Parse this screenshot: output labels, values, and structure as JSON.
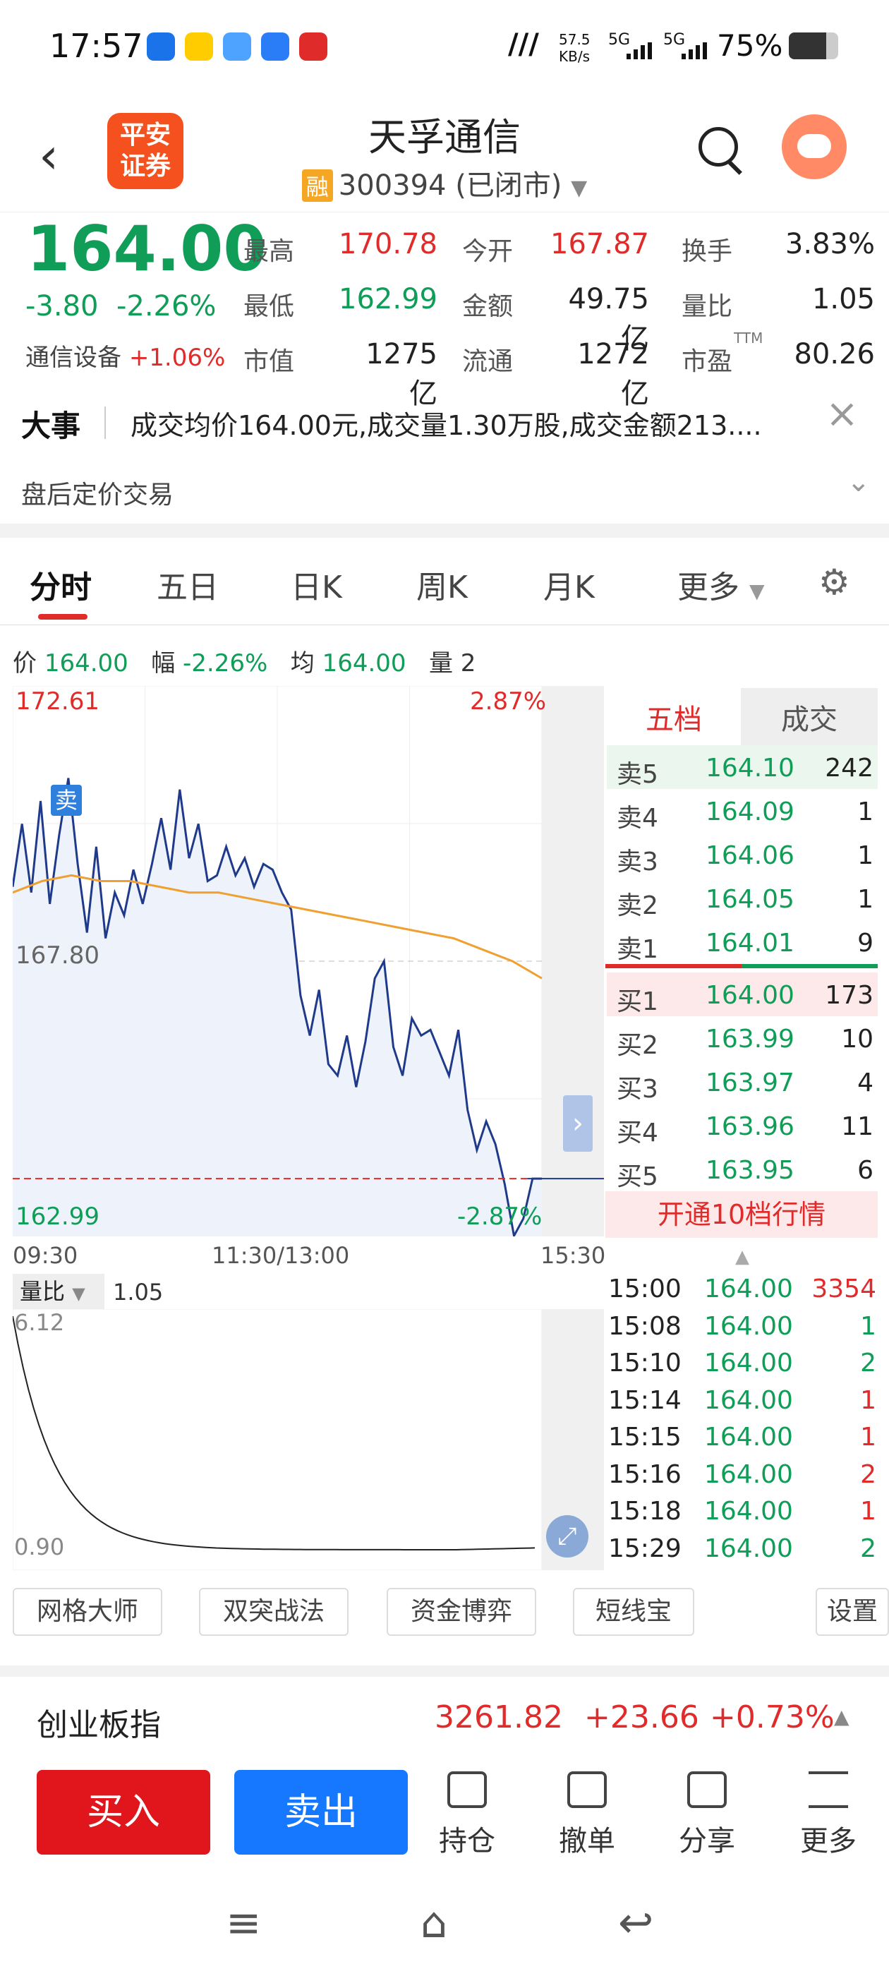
{
  "status_bar": {
    "time": "17:57",
    "speed": "57.5\nKB/s",
    "net1": "5G",
    "net2": "5G",
    "battery": "75%"
  },
  "header": {
    "logo_text": "平安\n证券",
    "title": "天孚通信",
    "tag": "融",
    "code": "300394 (已闭市)"
  },
  "quote": {
    "price": "164.00",
    "change": "-3.80",
    "change_pct": "-2.26%",
    "sector": "通信设备",
    "sector_pct": "+1.06%",
    "fields": [
      {
        "label": "最高",
        "value": "170.78",
        "color": "red"
      },
      {
        "label": "今开",
        "value": "167.87",
        "color": "red"
      },
      {
        "label": "换手",
        "value": "3.83%",
        "color": "dark"
      },
      {
        "label": "最低",
        "value": "162.99",
        "color": "green"
      },
      {
        "label": "金额",
        "value": "49.75亿",
        "color": "dark"
      },
      {
        "label": "量比",
        "value": "1.05",
        "color": "dark"
      },
      {
        "label": "市值",
        "value": "1275亿",
        "color": "dark"
      },
      {
        "label": "流通",
        "value": "1272亿",
        "color": "dark"
      },
      {
        "label": "市盈",
        "value": "80.26",
        "color": "dark",
        "sup": "TTM"
      }
    ]
  },
  "news": {
    "label": "大事",
    "text": "成交均价164.00元,成交量1.30万股,成交金额213....",
    "after_hours": "盘后定价交易"
  },
  "tabs": [
    "分时",
    "五日",
    "日K",
    "周K",
    "月K",
    "更多"
  ],
  "info_line": {
    "price_label": "价",
    "price": "164.00",
    "range_label": "幅",
    "range": "-2.26%",
    "avg_label": "均",
    "avg": "164.00",
    "vol_label": "量",
    "vol": "2"
  },
  "chart_labels": {
    "top_price": "172.61",
    "top_pct": "2.87%",
    "mid_price": "167.80",
    "bottom_price": "162.99",
    "bottom_pct": "-2.87%",
    "sell_marker": "卖",
    "time_start": "09:30",
    "time_mid": "11:30/13:00",
    "time_end": "15:30"
  },
  "chart_data": {
    "type": "line",
    "ylim": [
      162.99,
      172.61
    ],
    "series": [
      {
        "values": [
          169.1,
          170.2,
          169.0,
          170.6,
          168.8,
          170.0,
          171.0,
          169.5,
          168.3,
          169.8,
          168.2,
          169.0,
          168.6,
          169.4,
          168.8,
          169.5,
          170.3,
          169.4,
          170.8,
          169.6,
          170.2,
          169.2,
          169.3,
          169.8,
          169.3,
          169.6,
          169.1,
          169.5,
          169.4,
          169.0,
          168.7,
          167.2,
          166.5,
          167.3,
          166.0,
          165.8,
          166.5,
          165.6,
          166.4,
          167.5,
          167.8,
          166.3,
          165.8,
          166.8,
          166.5,
          166.6,
          166.2,
          165.8,
          166.6,
          165.2,
          164.5,
          165.0,
          164.6,
          163.9,
          163.0,
          163.3,
          164.0,
          164.0
        ]
      },
      {
        "values": [
          169.0,
          169.2,
          169.3,
          169.2,
          169.2,
          169.1,
          169.0,
          169.0,
          168.9,
          168.8,
          168.7,
          168.6,
          168.5,
          168.4,
          168.3,
          168.2,
          168.0,
          167.8,
          167.5
        ]
      }
    ]
  },
  "order_book": {
    "tab_active": "五档",
    "tab_other": "成交",
    "asks": [
      {
        "label": "卖5",
        "price": "164.10",
        "vol": "242"
      },
      {
        "label": "卖4",
        "price": "164.09",
        "vol": "1"
      },
      {
        "label": "卖3",
        "price": "164.06",
        "vol": "1"
      },
      {
        "label": "卖2",
        "price": "164.05",
        "vol": "1"
      },
      {
        "label": "卖1",
        "price": "164.01",
        "vol": "9"
      }
    ],
    "bids": [
      {
        "label": "买1",
        "price": "164.00",
        "vol": "173"
      },
      {
        "label": "买2",
        "price": "163.99",
        "vol": "10"
      },
      {
        "label": "买3",
        "price": "163.97",
        "vol": "4"
      },
      {
        "label": "买4",
        "price": "163.96",
        "vol": "11"
      },
      {
        "label": "买5",
        "price": "163.95",
        "vol": "6"
      }
    ],
    "upgrade": "开通10档行情"
  },
  "trades": [
    {
      "time": "15:00",
      "price": "164.00",
      "vol": "3354",
      "c": "red"
    },
    {
      "time": "15:08",
      "price": "164.00",
      "vol": "1",
      "c": "green"
    },
    {
      "time": "15:10",
      "price": "164.00",
      "vol": "2",
      "c": "green"
    },
    {
      "time": "15:14",
      "price": "164.00",
      "vol": "1",
      "c": "red"
    },
    {
      "time": "15:15",
      "price": "164.00",
      "vol": "1",
      "c": "red"
    },
    {
      "time": "15:16",
      "price": "164.00",
      "vol": "2",
      "c": "red"
    },
    {
      "time": "15:18",
      "price": "164.00",
      "vol": "1",
      "c": "red"
    },
    {
      "time": "15:29",
      "price": "164.00",
      "vol": "2",
      "c": "green"
    }
  ],
  "volume_chart": {
    "selector": "量比",
    "value": "1.05",
    "top": "6.12",
    "bottom": "0.90"
  },
  "tools": [
    "网格大师",
    "双突战法",
    "资金博弈",
    "短线宝",
    "设置"
  ],
  "index": {
    "name": "创业板指",
    "value": "3261.82",
    "change": "+23.66",
    "pct": "+0.73%"
  },
  "bottom": {
    "buy": "买入",
    "sell": "卖出",
    "actions": [
      "持仓",
      "撤单",
      "分享",
      "更多"
    ]
  }
}
